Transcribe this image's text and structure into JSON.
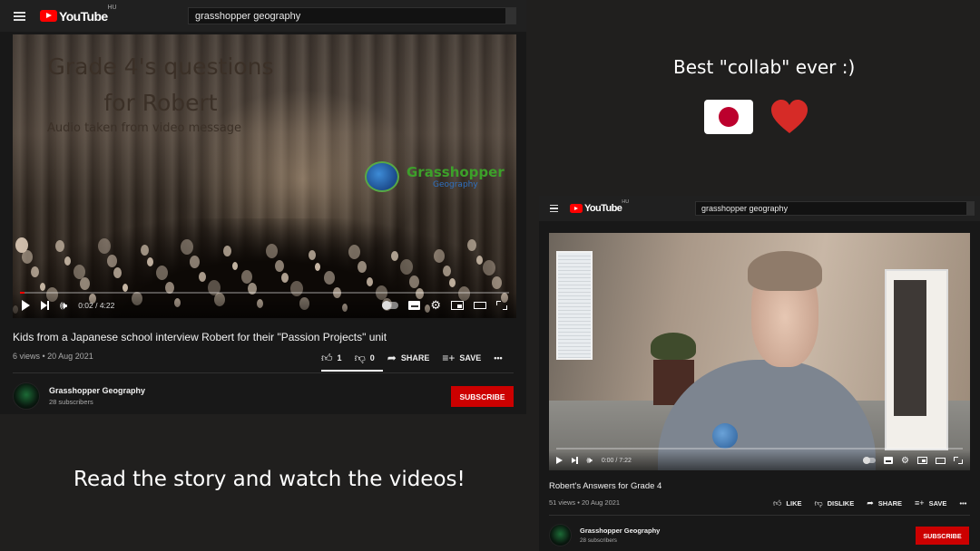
{
  "overlay": {
    "collab_text": "Best \"collab\" ever :)",
    "cta_text": "Read the story and watch the videos!",
    "flag_icon": "japan-flag-icon",
    "heart_icon": "red-heart-icon",
    "heart_color": "#d62b27"
  },
  "player1": {
    "logo_text": "YouTube",
    "logo_country": "HU",
    "search_value": "grasshopper geography",
    "thumbnail": {
      "title_line1": "Grade 4's questions",
      "title_line2": "for Robert",
      "subtitle": "Audio taken from video message",
      "brand_name": "Grasshopper",
      "brand_tag": "Geography"
    },
    "time": "0:02 / 4:22",
    "progress": 0.01,
    "video_title": "Kids from a Japanese school interview Robert for their \"Passion Projects\" unit",
    "meta": "6 views • 20 Aug 2021",
    "like_count": "1",
    "dislike_count": "0",
    "share_label": "SHARE",
    "save_label": "SAVE",
    "more_label": "•••",
    "channel_name": "Grasshopper Geography",
    "channel_subs": "28 subscribers",
    "subscribe_label": "SUBSCRIBE"
  },
  "player2": {
    "logo_text": "YouTube",
    "logo_country": "HU",
    "search_value": "grasshopper geography",
    "time": "0:00 / 7:22",
    "progress": 0.0,
    "video_title": "Robert's Answers for Grade 4",
    "meta": "51 views • 20 Aug 2021",
    "like_label": "LIKE",
    "dislike_label": "DISLIKE",
    "share_label": "SHARE",
    "save_label": "SAVE",
    "more_label": "•••",
    "channel_name": "Grasshopper Geography",
    "channel_subs": "28 subscribers",
    "subscribe_label": "SUBSCRIBE"
  },
  "colors": {
    "brand_red": "#ff0000",
    "subscribe_red": "#cc0000",
    "page_bg": "#201f1e"
  }
}
